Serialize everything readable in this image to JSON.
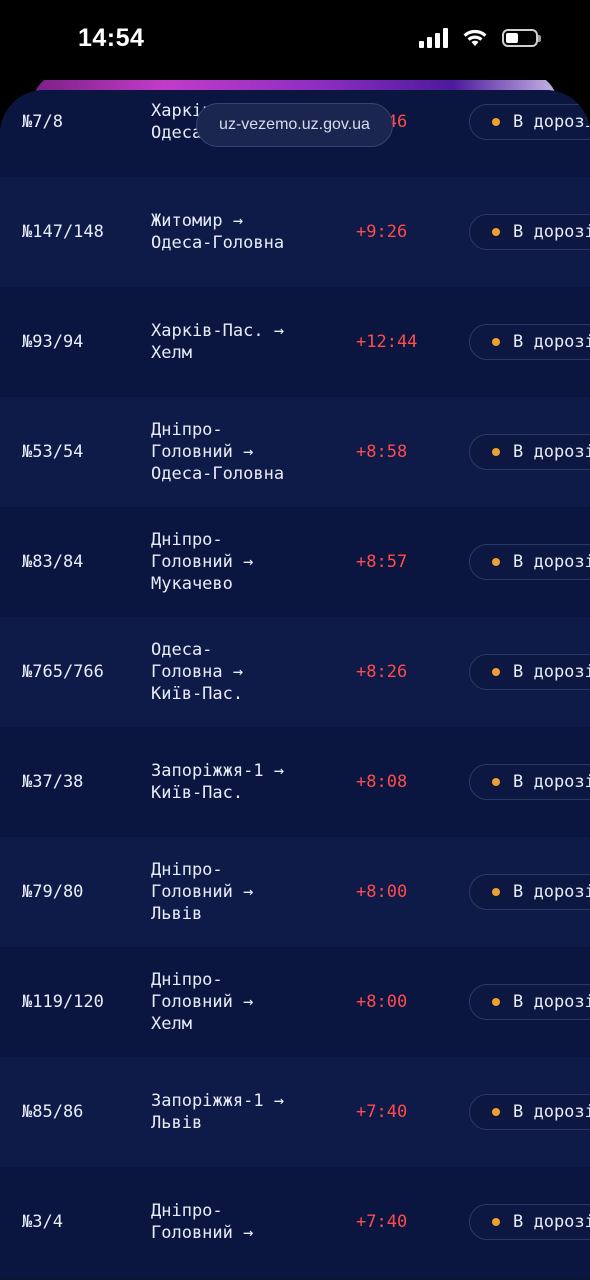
{
  "status_bar": {
    "time": "14:54"
  },
  "browser": {
    "url": "uz-vezemo.uz.gov.ua"
  },
  "colors": {
    "delay": "#ff4b4b",
    "status_dot": "#f0a030",
    "background": "#0a1538"
  },
  "trains": [
    {
      "number": "№7/8",
      "route": "Харків-Пас. →\nОдеса-Головна",
      "delay": "+9:46",
      "status": "В дорозі"
    },
    {
      "number": "№147/148",
      "route": "Житомир →\nОдеса-Головна",
      "delay": "+9:26",
      "status": "В дорозі"
    },
    {
      "number": "№93/94",
      "route": "Харків-Пас. →\nХелм",
      "delay": "+12:44",
      "status": "В дорозі"
    },
    {
      "number": "№53/54",
      "route": "Дніпро-\nГоловний →\nОдеса-Головна",
      "delay": "+8:58",
      "status": "В дорозі"
    },
    {
      "number": "№83/84",
      "route": "Дніпро-\nГоловний →\nМукачево",
      "delay": "+8:57",
      "status": "В дорозі"
    },
    {
      "number": "№765/766",
      "route": "Одеса-\nГоловна →\nКиїв-Пас.",
      "delay": "+8:26",
      "status": "В дорозі"
    },
    {
      "number": "№37/38",
      "route": "Запоріжжя-1 →\nКиїв-Пас.",
      "delay": "+8:08",
      "status": "В дорозі"
    },
    {
      "number": "№79/80",
      "route": "Дніпро-\nГоловний →\nЛьвів",
      "delay": "+8:00",
      "status": "В дорозі"
    },
    {
      "number": "№119/120",
      "route": "Дніпро-\nГоловний →\nХелм",
      "delay": "+8:00",
      "status": "В дорозі"
    },
    {
      "number": "№85/86",
      "route": "Запоріжжя-1 →\nЛьвів",
      "delay": "+7:40",
      "status": "В дорозі"
    },
    {
      "number": "№3/4",
      "route": "Дніпро-\nГоловний →",
      "delay": "+7:40",
      "status": "В дорозі"
    }
  ]
}
